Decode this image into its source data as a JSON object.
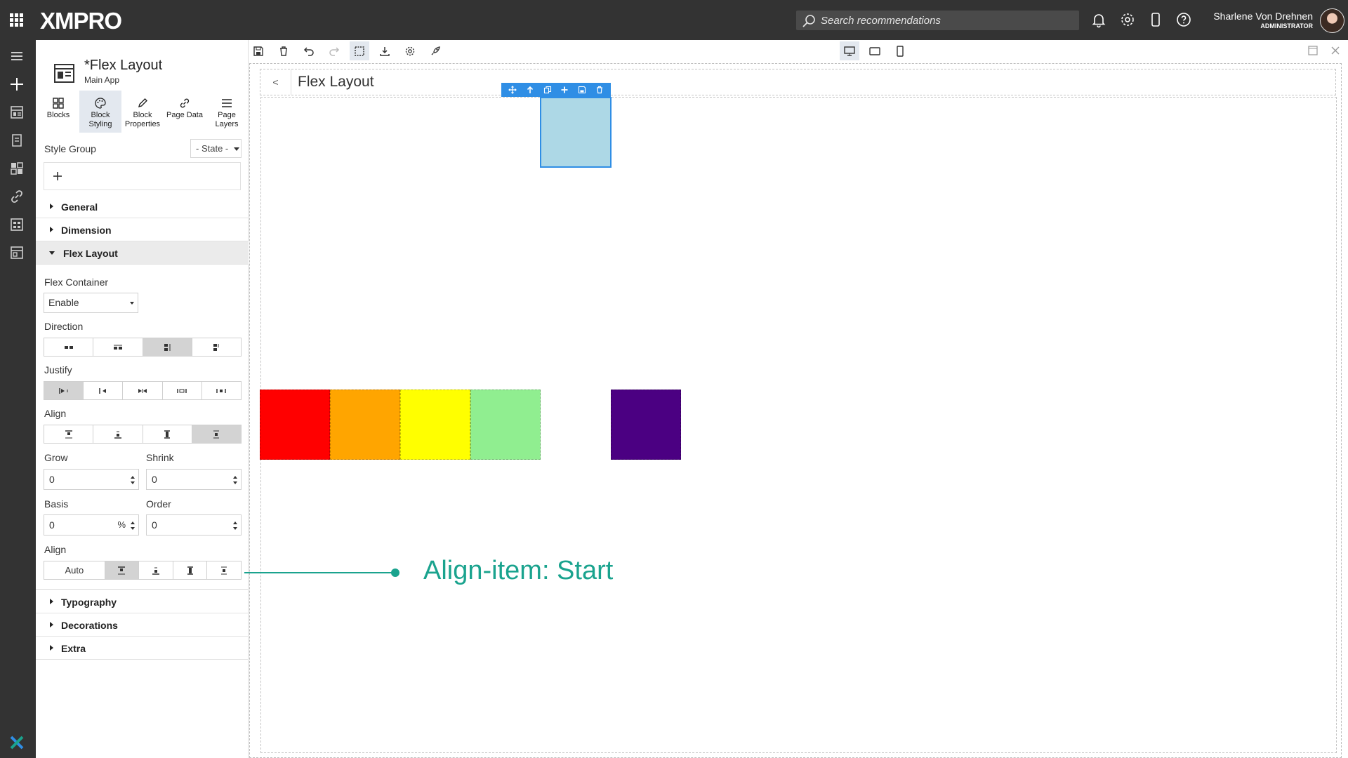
{
  "app": {
    "logo": "XMPRO"
  },
  "search": {
    "placeholder": "Search recommendations"
  },
  "user": {
    "name": "Sharlene Von Drehnen",
    "role": "ADMINISTRATOR"
  },
  "page": {
    "title": "*Flex Layout",
    "subtitle": "Main App"
  },
  "tools": [
    {
      "label": "Blocks",
      "icon": "blocks-icon"
    },
    {
      "label": "Block Styling",
      "icon": "palette-icon"
    },
    {
      "label": "Block Properties",
      "icon": "pencil-icon"
    },
    {
      "label": "Page Data",
      "icon": "link-icon"
    },
    {
      "label": "Page Layers",
      "icon": "layers-icon"
    }
  ],
  "style_group": {
    "label": "Style Group",
    "state": "- State -"
  },
  "sections": {
    "general": "General",
    "dimension": "Dimension",
    "flex_layout": "Flex Layout",
    "typography": "Typography",
    "decorations": "Decorations",
    "extra": "Extra"
  },
  "flex": {
    "container_label": "Flex Container",
    "container_value": "Enable",
    "direction_label": "Direction",
    "justify_label": "Justify",
    "align_label": "Align",
    "grow_label": "Grow",
    "grow_value": "0",
    "shrink_label": "Shrink",
    "shrink_value": "0",
    "basis_label": "Basis",
    "basis_value": "0",
    "basis_unit": "%",
    "order_label": "Order",
    "order_value": "0",
    "self_align_label": "Align",
    "self_align_auto": "Auto"
  },
  "canvas": {
    "back": "<",
    "title": "Flex Layout"
  },
  "blocks": {
    "selected_color": "#add8e6",
    "colors": [
      "#ff0000",
      "#ffa500",
      "#ffff00",
      "#90ee90",
      "#4b0082"
    ]
  },
  "annotation": {
    "text": "Align-item: Start",
    "color": "#1aa38e"
  },
  "theme": {
    "chrome": "#333333",
    "accent": "#2f8ee5"
  }
}
